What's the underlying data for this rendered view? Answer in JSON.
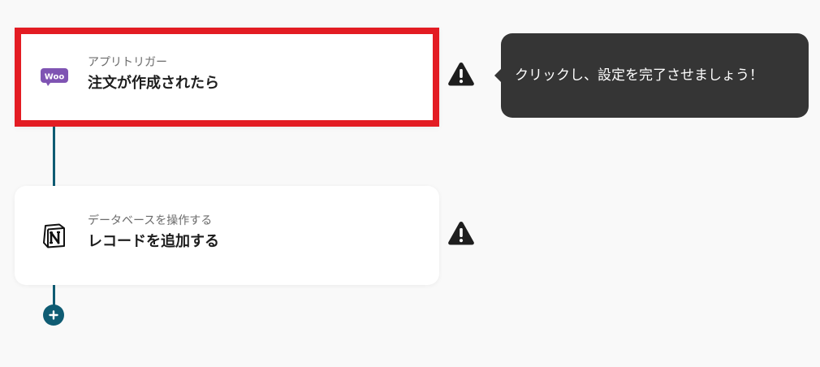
{
  "trigger_card": {
    "subtitle": "アプリトリガー",
    "title": "注文が作成されたら",
    "icon": "woocommerce-icon",
    "icon_text": "Woo",
    "highlight_color": "#e31c23"
  },
  "action_card": {
    "subtitle": "データベースを操作する",
    "title": "レコードを追加する",
    "icon": "notion-icon"
  },
  "tooltip": {
    "text": "クリックし、設定を完了させましょう！"
  },
  "warnings": [
    {
      "icon": "warning-icon"
    },
    {
      "icon": "warning-icon"
    }
  ],
  "add_button": {
    "icon": "plus-icon"
  },
  "colors": {
    "connector": "#0f5c73",
    "tooltip_bg": "#353535",
    "woo_purple": "#7f54b3",
    "background": "#f9f9f9"
  }
}
